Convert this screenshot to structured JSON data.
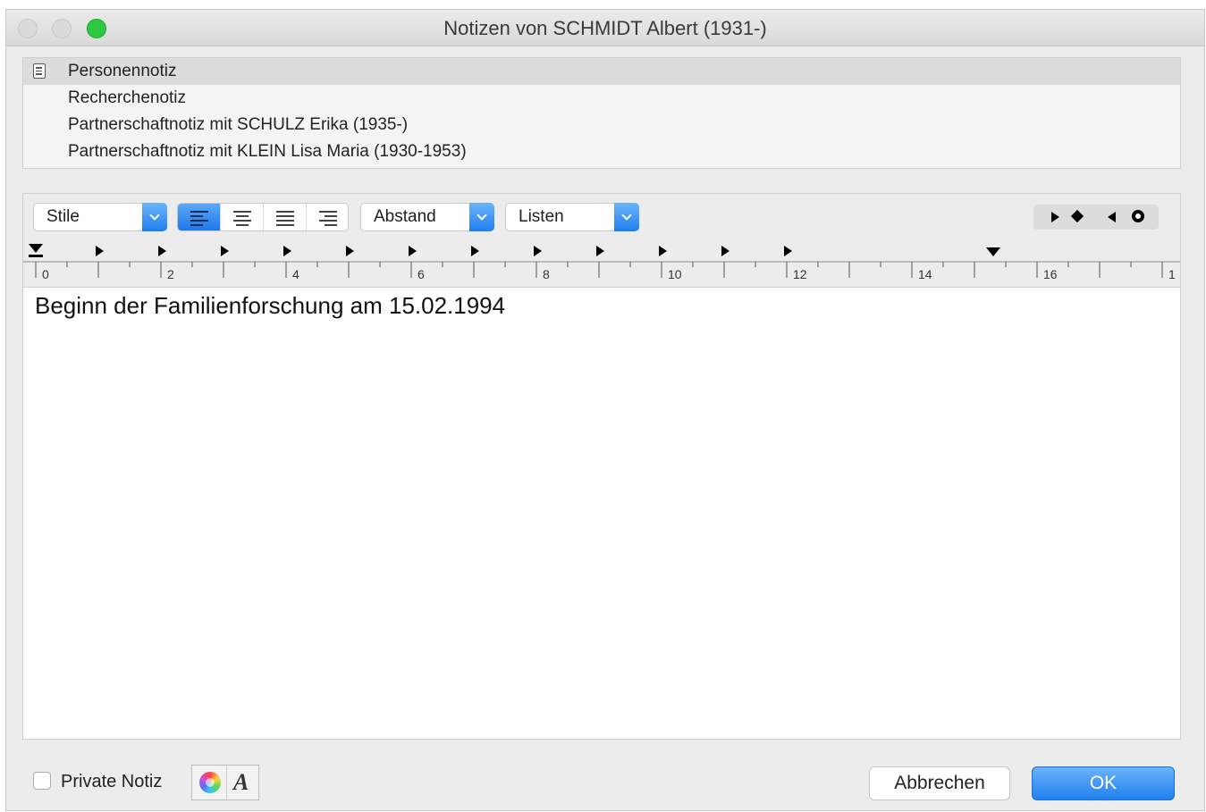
{
  "window": {
    "title": "Notizen von SCHMIDT Albert (1931-)"
  },
  "notes": [
    {
      "label": "Personennotiz",
      "selected": true,
      "icon": "note-document-icon"
    },
    {
      "label": "Recherchenotiz",
      "selected": false
    },
    {
      "label": "Partnerschaftnotiz mit SCHULZ Erika (1935-)",
      "selected": false
    },
    {
      "label": "Partnerschaftnotiz mit KLEIN Lisa Maria (1930-1953)",
      "selected": false
    }
  ],
  "toolbar": {
    "styles_label": "Stile",
    "spacing_label": "Abstand",
    "lists_label": "Listen",
    "alignment_selected": "left",
    "tab_stop_icons": [
      "right-tab-icon",
      "center-tab-icon",
      "left-tab-icon",
      "decimal-tab-icon"
    ]
  },
  "ruler": {
    "numbers": [
      "0",
      "2",
      "4",
      "6",
      "8",
      "10",
      "12",
      "14",
      "16",
      "1"
    ]
  },
  "editor": {
    "text": "Beginn der Familienforschung am 15.02.1994"
  },
  "footer": {
    "private_label": "Private Notiz",
    "private_checked": false,
    "cancel_label": "Abbrechen",
    "ok_label": "OK"
  },
  "colors": {
    "accent": "#1f7fee",
    "zoom_button": "#2cc840"
  }
}
